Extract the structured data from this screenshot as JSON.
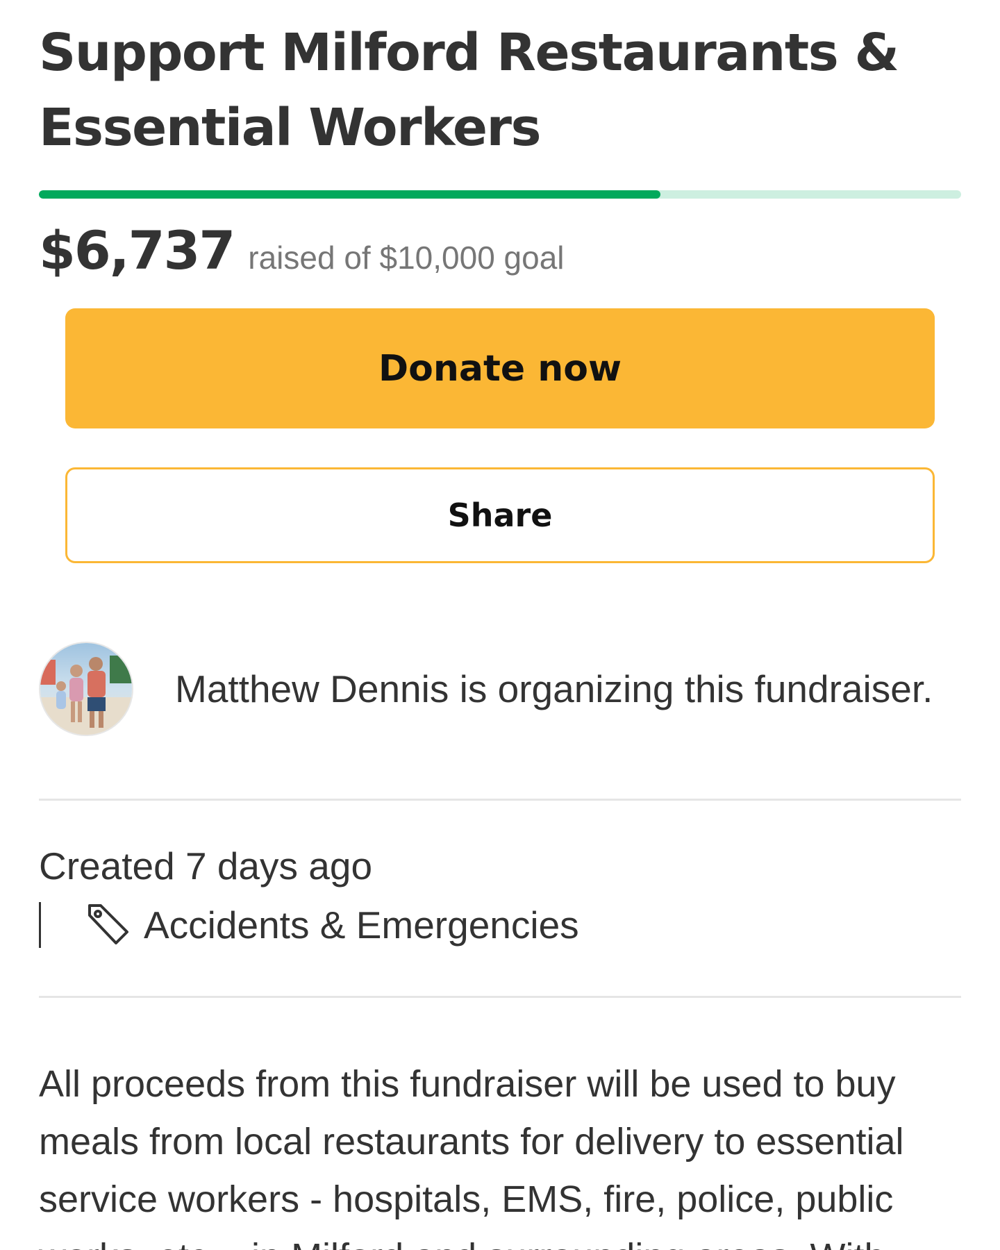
{
  "campaign": {
    "title": "Support Milford Restaurants & Essential Workers",
    "raised": "$6,737",
    "goal_text": "raised of $10,000 goal",
    "progress_fraction": 0.6737,
    "progress_color": "#02a95c",
    "progress_track_color": "#cdefe0"
  },
  "actions": {
    "donate_label": "Donate now",
    "share_label": "Share",
    "accent_color": "#fbb735"
  },
  "organizer": {
    "text": "Matthew Dennis is organizing this fundraiser.",
    "avatar_icon": "avatar-photo"
  },
  "meta": {
    "created": "Created 7 days ago",
    "category_icon": "tag-icon",
    "category": "Accidents & Emergencies"
  },
  "story": {
    "text": "All proceeds from this fundraiser will be used to buy meals from local restaurants for delivery to essential service workers - hospitals, EMS, fire, police, public works, etc. - in Milford and surrounding areas. With"
  }
}
